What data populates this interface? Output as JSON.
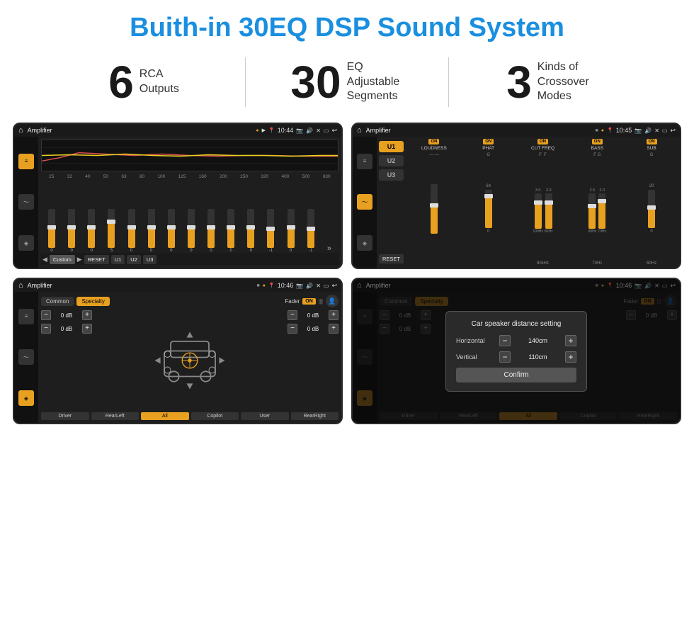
{
  "title": "Buith-in 30EQ DSP Sound System",
  "stats": [
    {
      "number": "6",
      "label": "RCA\nOutputs"
    },
    {
      "number": "30",
      "label": "EQ Adjustable\nSegments"
    },
    {
      "number": "3",
      "label": "Kinds of\nCrossover Modes"
    }
  ],
  "screens": {
    "eq": {
      "title": "Amplifier",
      "time": "10:44",
      "frequencies": [
        "25",
        "32",
        "40",
        "50",
        "63",
        "80",
        "100",
        "125",
        "160",
        "200",
        "250",
        "320",
        "400",
        "500",
        "630"
      ],
      "values": [
        "0",
        "0",
        "0",
        "5",
        "0",
        "0",
        "0",
        "0",
        "0",
        "0",
        "0",
        "-1",
        "0",
        "-1"
      ],
      "presets": [
        "Custom",
        "RESET",
        "U1",
        "U2",
        "U3"
      ]
    },
    "crossover": {
      "title": "Amplifier",
      "time": "10:45",
      "uButtons": [
        "U1",
        "U2",
        "U3"
      ],
      "channels": [
        "LOUDNESS",
        "PHAT",
        "CUT FREQ",
        "BASS",
        "SUB"
      ]
    },
    "fader": {
      "title": "Amplifier",
      "time": "10:46",
      "tabs": [
        "Common",
        "Specialty"
      ],
      "faderLabel": "Fader",
      "onToggle": "ON",
      "dbValues": [
        "0 dB",
        "0 dB",
        "0 dB",
        "0 dB"
      ],
      "bottomBtns": [
        "Driver",
        "RearLeft",
        "All",
        "Copilot",
        "User",
        "RearRight"
      ]
    },
    "distance": {
      "title": "Amplifier",
      "time": "10:46",
      "tabs": [
        "Common",
        "Specialty"
      ],
      "dialogTitle": "Car speaker distance setting",
      "horizontal": {
        "label": "Horizontal",
        "value": "140cm"
      },
      "vertical": {
        "label": "Vertical",
        "value": "110cm"
      },
      "confirmLabel": "Confirm",
      "dbValues": [
        "0 dB",
        "0 dB"
      ],
      "bottomBtns": [
        "Driver",
        "RearLeft",
        "All",
        "Copilot",
        "RearRight"
      ]
    }
  }
}
